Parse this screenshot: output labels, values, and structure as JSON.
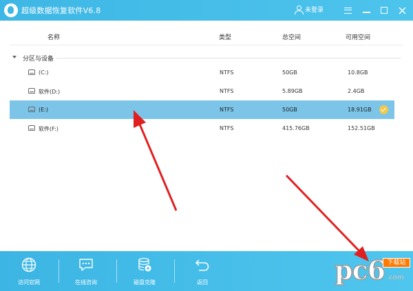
{
  "window": {
    "title": "超级数据恢复软件V6.8",
    "login_label": "未登录",
    "accent_color": "#3fb7e6"
  },
  "table": {
    "headers": {
      "name": "名称",
      "type": "类型",
      "total": "总空间",
      "available": "可用空间"
    },
    "group_label": "分区与设备",
    "rows": [
      {
        "name": "(C:)",
        "type": "NTFS",
        "total": "50GB",
        "available": "10.8GB",
        "selected": false
      },
      {
        "name": "软件(D:)",
        "type": "NTFS",
        "total": "5.89GB",
        "available": "2.4GB",
        "selected": false
      },
      {
        "name": "(E:)",
        "type": "NTFS",
        "total": "50GB",
        "available": "18.91GB",
        "selected": true
      },
      {
        "name": "软件(F:)",
        "type": "NTFS",
        "total": "415.76GB",
        "available": "152.51GB",
        "selected": false
      }
    ],
    "selected_color": "#7cc5e8"
  },
  "toolbar": {
    "items": [
      {
        "label": "访问官网",
        "icon": "globe-icon"
      },
      {
        "label": "在线咨询",
        "icon": "chat-icon"
      },
      {
        "label": "磁盘克隆",
        "icon": "disk-clone-icon"
      },
      {
        "label": "返回",
        "icon": "back-arrow-icon"
      }
    ]
  },
  "watermark": {
    "logo_text": "pc6",
    "badge": "下载站",
    "url": ".com"
  },
  "annotation_color": "#e02020"
}
